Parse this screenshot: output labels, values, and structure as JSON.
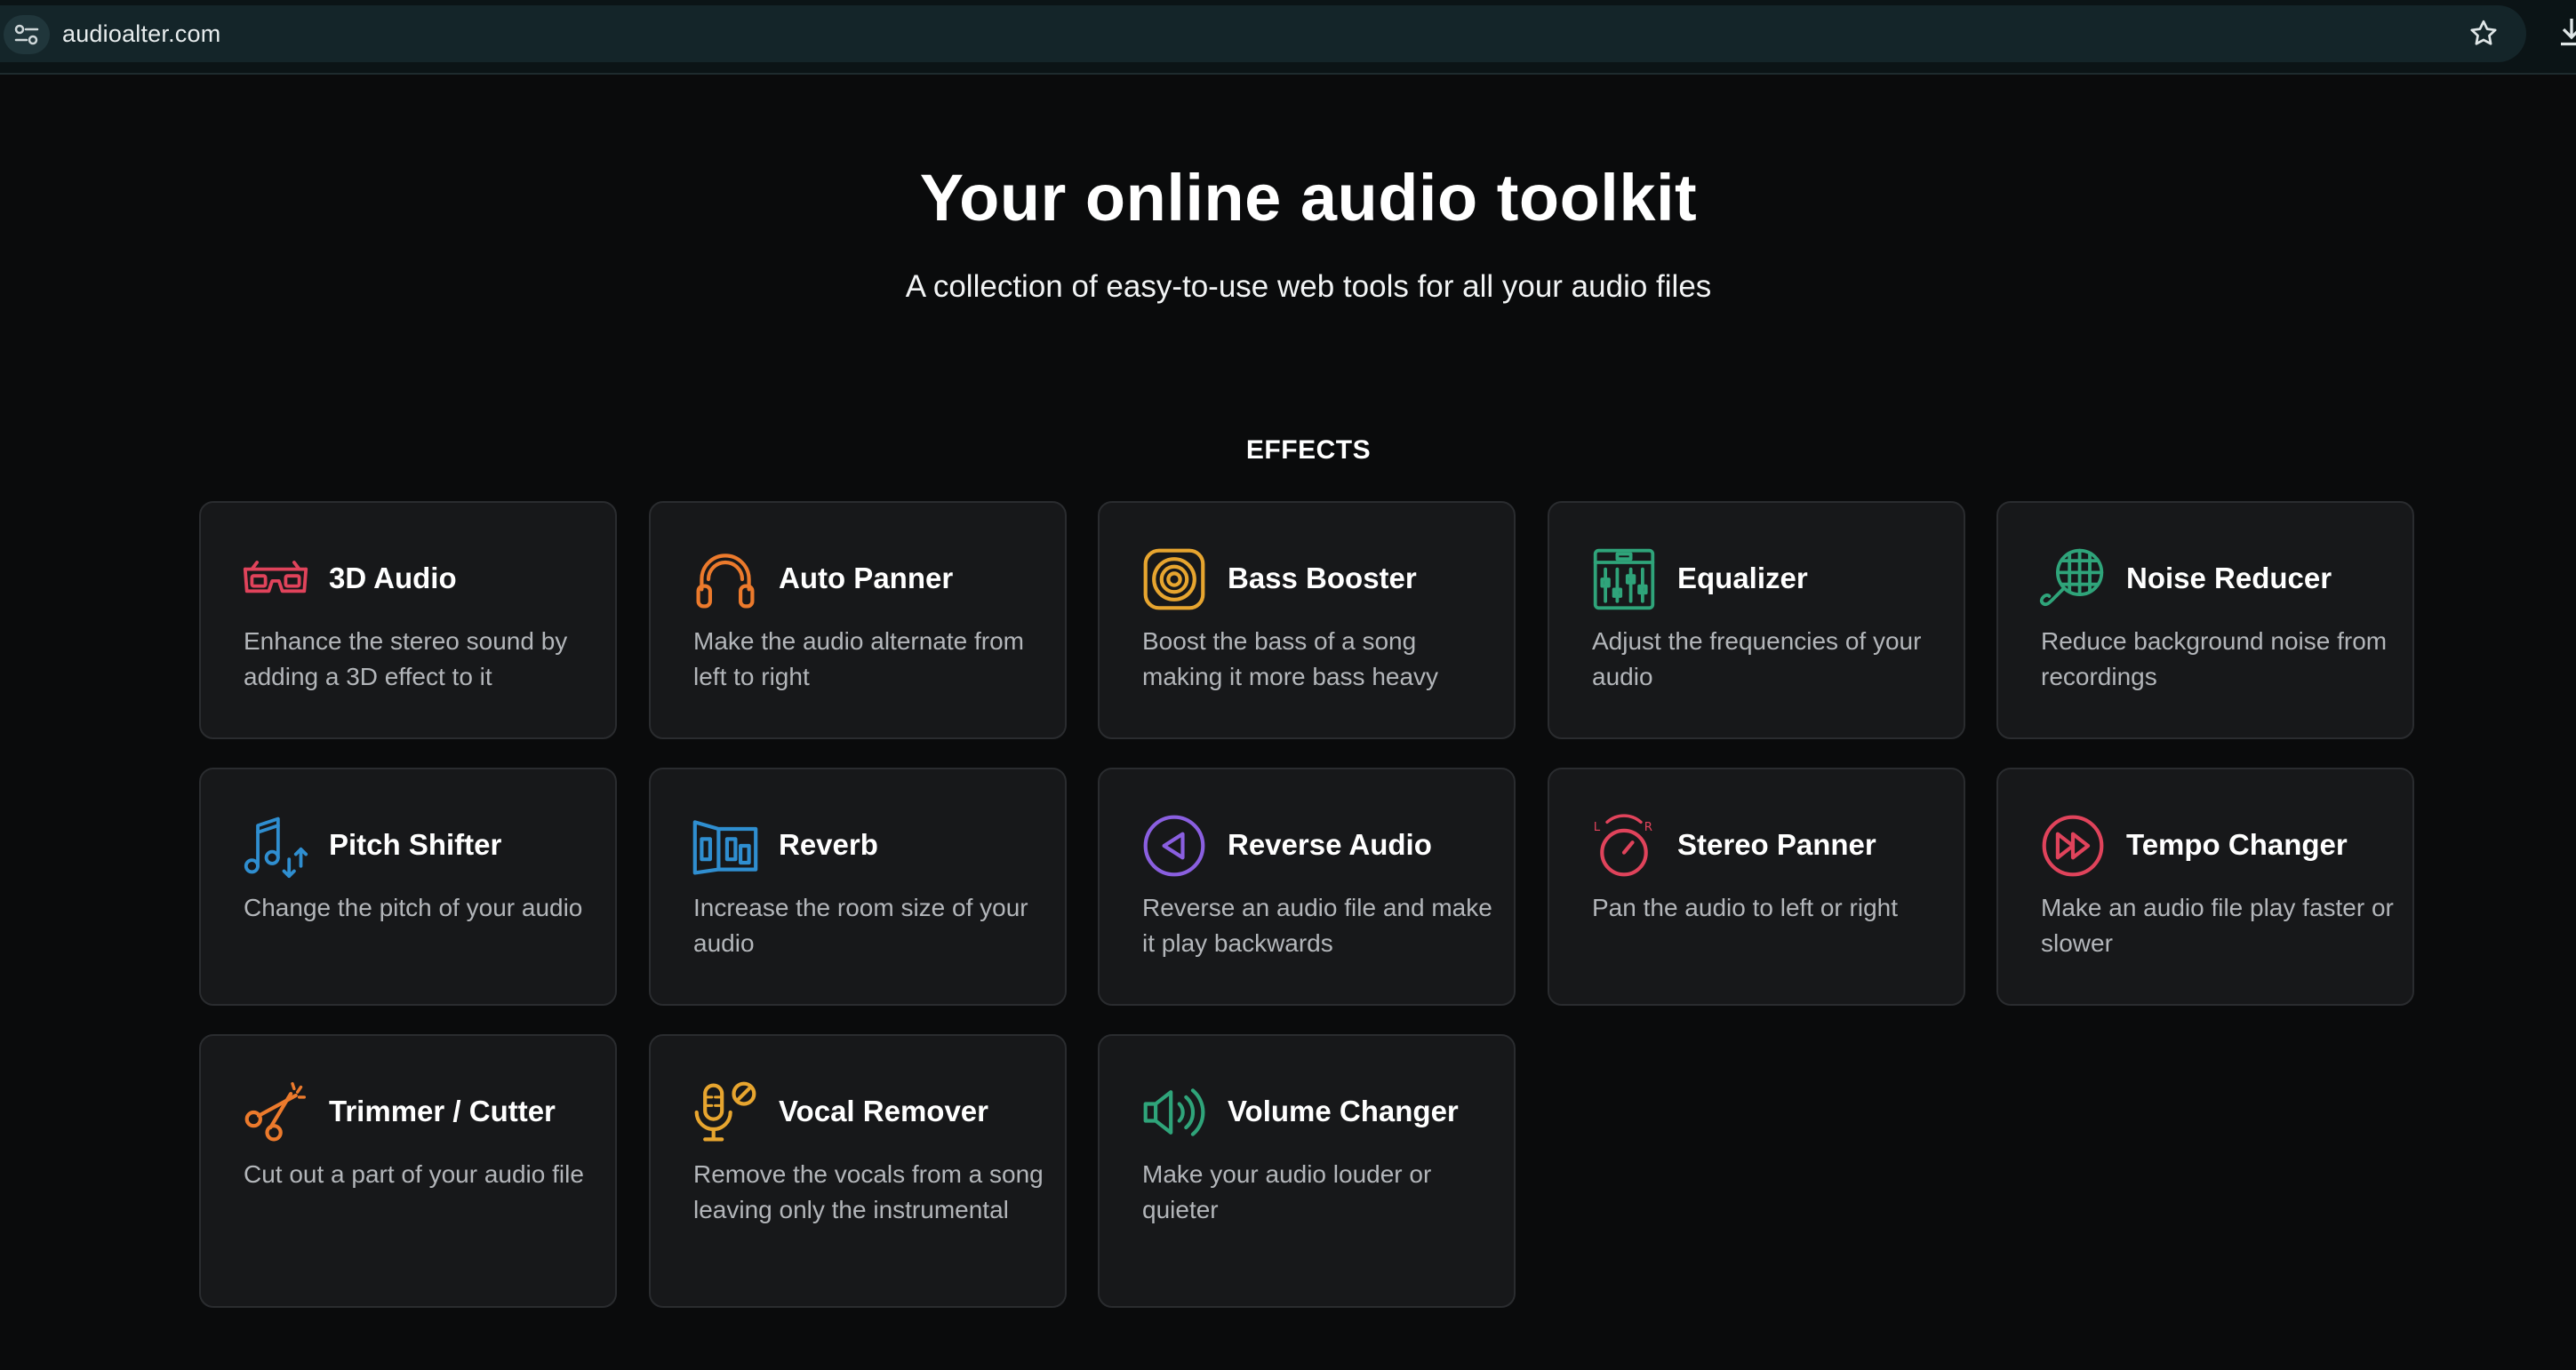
{
  "browser": {
    "url": "audioalter.com",
    "icons": [
      "site-info-icon",
      "bookmark-star-icon",
      "download-icon"
    ]
  },
  "hero": {
    "title": "Your online audio toolkit",
    "subtitle": "A collection of easy-to-use web tools for all your audio files"
  },
  "section": {
    "label": "EFFECTS"
  },
  "tools": [
    {
      "title": "3D Audio",
      "desc": "Enhance the stereo sound by adding a 3D effect to it",
      "icon": "3d-glasses-icon",
      "color": "#e0435b"
    },
    {
      "title": "Auto Panner",
      "desc": "Make the audio alternate from left to right",
      "icon": "headphones-icon",
      "color": "#ec7a2c"
    },
    {
      "title": "Bass Booster",
      "desc": "Boost the bass of a song making it more bass heavy",
      "icon": "speaker-icon",
      "color": "#e7a52f"
    },
    {
      "title": "Equalizer",
      "desc": "Adjust the frequencies of your audio",
      "icon": "equalizer-icon",
      "color": "#2fa47a"
    },
    {
      "title": "Noise Reducer",
      "desc": "Reduce background noise from recordings",
      "icon": "microphone-mesh-icon",
      "color": "#2fa47a"
    },
    {
      "title": "Pitch Shifter",
      "desc": "Change the pitch of your audio",
      "icon": "music-note-updown-icon",
      "color": "#2f8ed0"
    },
    {
      "title": "Reverb",
      "desc": "Increase the room size of your audio",
      "icon": "room-icon",
      "color": "#2f8ed0"
    },
    {
      "title": "Reverse Audio",
      "desc": "Reverse an audio file and make it play backwards",
      "icon": "reverse-play-icon",
      "color": "#8a5fe0"
    },
    {
      "title": "Stereo Panner",
      "desc": "Pan the audio to left or right",
      "icon": "pan-knob-icon",
      "color": "#e0435b"
    },
    {
      "title": "Tempo Changer",
      "desc": "Make an audio file play faster or slower",
      "icon": "fast-forward-icon",
      "color": "#e0435b"
    },
    {
      "title": "Trimmer / Cutter",
      "desc": "Cut out a part of your audio file",
      "icon": "scissors-icon",
      "color": "#ec7a2c"
    },
    {
      "title": "Vocal Remover",
      "desc": "Remove the vocals from a song leaving only the instrumental",
      "icon": "microphone-off-icon",
      "color": "#e7a52f"
    },
    {
      "title": "Volume Changer",
      "desc": "Make your audio louder or quieter",
      "icon": "volume-icon",
      "color": "#2fa47a"
    }
  ]
}
